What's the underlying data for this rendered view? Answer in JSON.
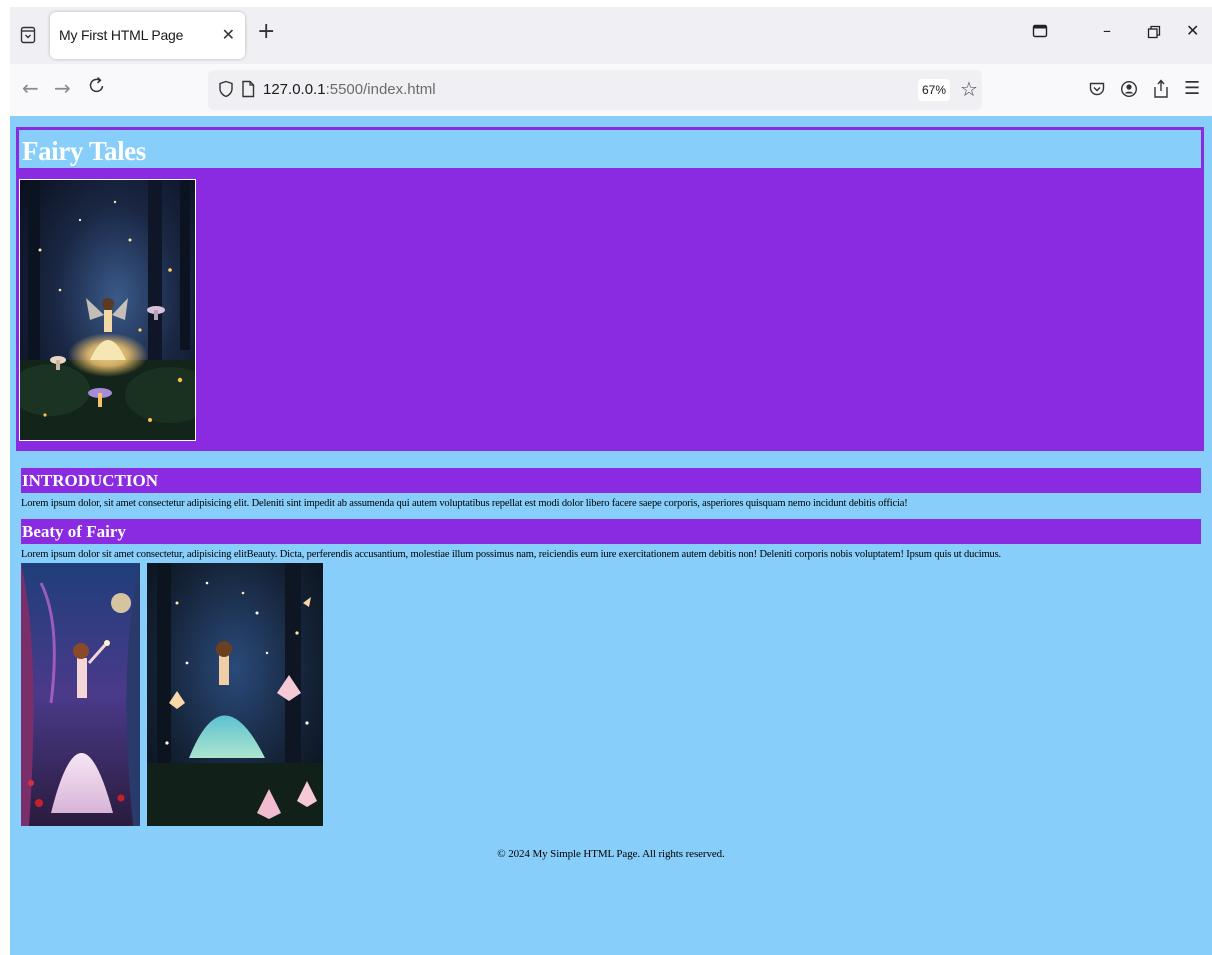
{
  "browser": {
    "tab": {
      "title": "My First HTML Page"
    },
    "url": {
      "host": "127.0.0.1",
      "rest": ":5500/index.html"
    },
    "zoom": "67%"
  },
  "page": {
    "title": "Fairy Tales",
    "sections": [
      {
        "heading": "INTRODUCTION",
        "text": "Lorem ipsum dolor, sit amet consectetur adipisicing elit. Deleniti sint impedit ab assumenda qui autem voluptatibus repellat est modi dolor libero facere saepe corporis, asperiores quisquam nemo incidunt debitis officia!"
      },
      {
        "heading": "Beaty of Fairy",
        "text": "Lorem ipsum dolor sit amet consectetur, adipisicing elitBeauty. Dicta, perferendis accusantium, molestiae illum possimus nam, reiciendis eum iure exercitationem autem debitis non! Deleniti corporis nobis voluptatem! Ipsum quis ut ducimus."
      }
    ],
    "footer": "© 2024 My Simple HTML Page. All rights reserved."
  },
  "colors": {
    "page_bg": "#87cefa",
    "accent": "#8a2be2"
  },
  "icons": {
    "tab_list": "tab-list-icon",
    "close_tab": "close-icon",
    "new_tab": "plus-icon",
    "back": "back-arrow-icon",
    "forward": "forward-arrow-icon",
    "reload": "reload-icon",
    "shield": "shield-icon",
    "page": "page-icon",
    "bookmark": "star-icon",
    "pocket": "pocket-icon",
    "account": "account-icon",
    "extensions": "extensions-icon",
    "menu": "hamburger-menu-icon"
  }
}
